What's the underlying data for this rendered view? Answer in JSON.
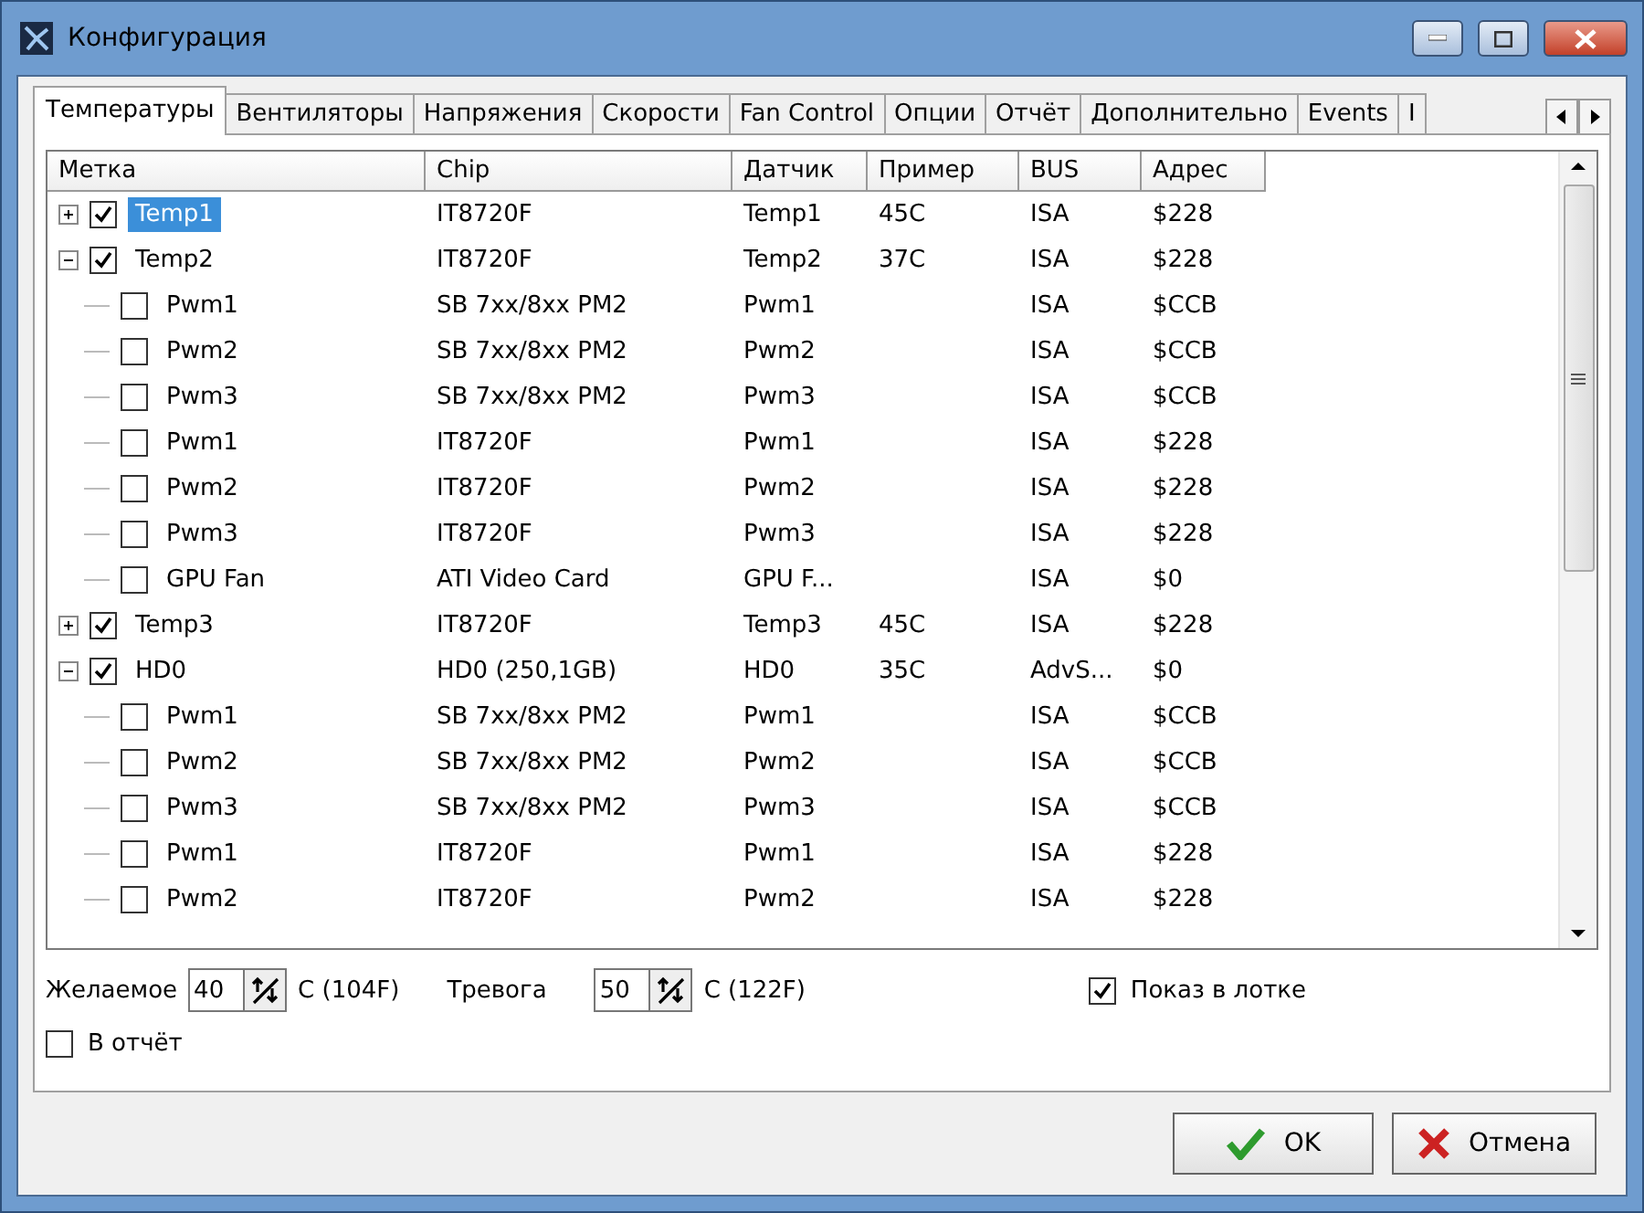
{
  "window": {
    "title": "Конфигурация"
  },
  "tabs": [
    {
      "label": "Температуры",
      "selected": true
    },
    {
      "label": "Вентиляторы",
      "selected": false
    },
    {
      "label": "Напряжения",
      "selected": false
    },
    {
      "label": "Скорости",
      "selected": false
    },
    {
      "label": "Fan Control",
      "selected": false
    },
    {
      "label": "Опции",
      "selected": false
    },
    {
      "label": "Отчёт",
      "selected": false
    },
    {
      "label": "Дополнительно",
      "selected": false
    },
    {
      "label": "Events",
      "selected": false
    },
    {
      "label": "I",
      "selected": false
    }
  ],
  "table": {
    "columns": [
      "Метка",
      "Chip",
      "Датчик",
      "Пример",
      "BUS",
      "Адрес"
    ],
    "rows": [
      {
        "label": "Temp1",
        "checked": true,
        "selected": true,
        "expanded": false,
        "chip": "IT8720F",
        "sensor": "Temp1",
        "sample": "45C",
        "bus": "ISA",
        "address": "$228",
        "children": []
      },
      {
        "label": "Temp2",
        "checked": true,
        "selected": false,
        "expanded": true,
        "chip": "IT8720F",
        "sensor": "Temp2",
        "sample": "37C",
        "bus": "ISA",
        "address": "$228",
        "children": [
          {
            "label": "Pwm1",
            "checked": false,
            "selected": false,
            "chip": "SB 7xx/8xx PM2",
            "sensor": "Pwm1",
            "bus": "ISA",
            "address": "$CCB"
          },
          {
            "label": "Pwm2",
            "checked": false,
            "selected": false,
            "chip": "SB 7xx/8xx PM2",
            "sensor": "Pwm2",
            "bus": "ISA",
            "address": "$CCB"
          },
          {
            "label": "Pwm3",
            "checked": false,
            "selected": false,
            "chip": "SB 7xx/8xx PM2",
            "sensor": "Pwm3",
            "bus": "ISA",
            "address": "$CCB"
          },
          {
            "label": "Pwm1",
            "checked": false,
            "selected": false,
            "chip": "IT8720F",
            "sensor": "Pwm1",
            "bus": "ISA",
            "address": "$228"
          },
          {
            "label": "Pwm2",
            "checked": false,
            "selected": false,
            "chip": "IT8720F",
            "sensor": "Pwm2",
            "bus": "ISA",
            "address": "$228"
          },
          {
            "label": "Pwm3",
            "checked": false,
            "selected": false,
            "chip": "IT8720F",
            "sensor": "Pwm3",
            "bus": "ISA",
            "address": "$228"
          },
          {
            "label": "GPU Fan",
            "checked": false,
            "selected": false,
            "chip": "ATI Video Card",
            "sensor": "GPU F...",
            "bus": "ISA",
            "address": "$0"
          }
        ]
      },
      {
        "label": "Temp3",
        "checked": true,
        "selected": false,
        "expanded": false,
        "chip": "IT8720F",
        "sensor": "Temp3",
        "sample": "45C",
        "bus": "ISA",
        "address": "$228",
        "children": []
      },
      {
        "label": "HD0",
        "checked": true,
        "selected": false,
        "expanded": true,
        "chip": "HD0 (250,1GB)",
        "sensor": "HD0",
        "sample": "35C",
        "bus": "AdvS...",
        "address": "$0",
        "children": [
          {
            "label": "Pwm1",
            "checked": false,
            "selected": false,
            "chip": "SB 7xx/8xx PM2",
            "sensor": "Pwm1",
            "bus": "ISA",
            "address": "$CCB"
          },
          {
            "label": "Pwm2",
            "checked": false,
            "selected": false,
            "chip": "SB 7xx/8xx PM2",
            "sensor": "Pwm2",
            "bus": "ISA",
            "address": "$CCB"
          },
          {
            "label": "Pwm3",
            "checked": false,
            "selected": false,
            "chip": "SB 7xx/8xx PM2",
            "sensor": "Pwm3",
            "bus": "ISA",
            "address": "$CCB"
          },
          {
            "label": "Pwm1",
            "checked": false,
            "selected": false,
            "chip": "IT8720F",
            "sensor": "Pwm1",
            "bus": "ISA",
            "address": "$228"
          },
          {
            "label": "Pwm2",
            "checked": false,
            "selected": false,
            "chip": "IT8720F",
            "sensor": "Pwm2",
            "bus": "ISA",
            "address": "$228"
          }
        ]
      }
    ]
  },
  "options": {
    "desired_label": "Желаемое",
    "desired_value": "40",
    "desired_unit": "C (104F)",
    "alarm_label": "Тревога",
    "alarm_value": "50",
    "alarm_unit": "C (122F)",
    "tray": {
      "label": "Показ в лотке",
      "checked": true
    },
    "report": {
      "label": "В отчёт",
      "checked": false
    }
  },
  "buttons": {
    "ok": "OK",
    "cancel": "Отмена"
  }
}
